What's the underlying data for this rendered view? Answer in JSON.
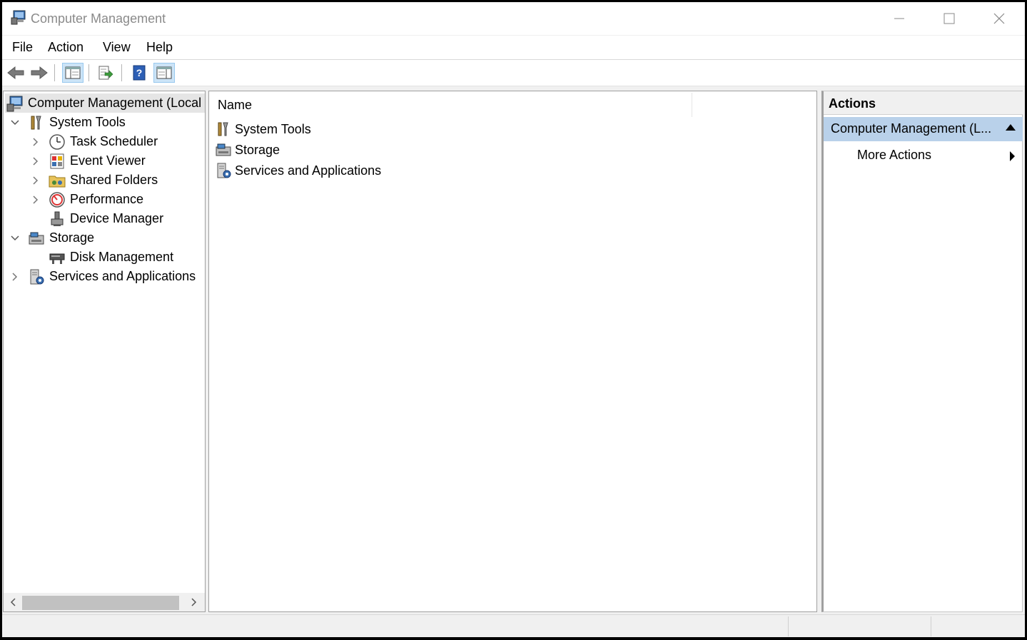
{
  "window": {
    "title": "Computer Management"
  },
  "menu": {
    "items": [
      "File",
      "Action",
      "View",
      "Help"
    ]
  },
  "toolbar": {
    "buttons": [
      "back-arrow-icon",
      "forward-arrow-icon",
      "show-hide-console-tree-icon",
      "export-list-icon",
      "help-icon",
      "show-hide-action-pane-icon"
    ]
  },
  "tree": {
    "root": "Computer Management (Local",
    "items": [
      {
        "label": "System Tools",
        "expanded": true
      },
      {
        "label": "Task Scheduler"
      },
      {
        "label": "Event Viewer"
      },
      {
        "label": "Shared Folders"
      },
      {
        "label": "Performance"
      },
      {
        "label": "Device Manager"
      },
      {
        "label": "Storage",
        "expanded": true
      },
      {
        "label": "Disk Management"
      },
      {
        "label": "Services and Applications",
        "expanded": false
      }
    ]
  },
  "content": {
    "column_name": "Name",
    "items": [
      "System Tools",
      "Storage",
      "Services and Applications"
    ]
  },
  "actions": {
    "title": "Actions",
    "group": "Computer Management (L...",
    "items": [
      "More Actions"
    ]
  },
  "colors": {
    "selection": "#b9d1ea",
    "toolbar_active": "#cce4f7"
  }
}
